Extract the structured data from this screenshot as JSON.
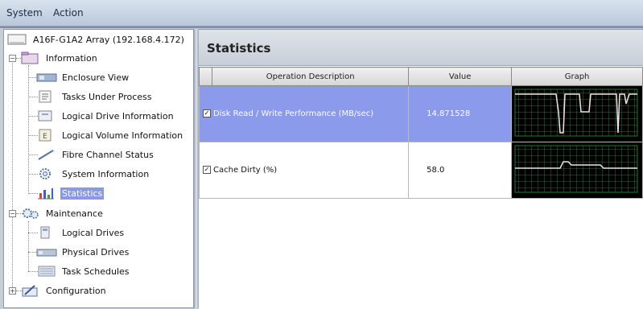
{
  "menu": {
    "items": [
      "System",
      "Action"
    ]
  },
  "tree": {
    "root": "A16F-G1A2 Array (192.168.4.172)",
    "information": {
      "label": "Information",
      "children": [
        "Enclosure View",
        "Tasks Under Process",
        "Logical Drive Information",
        "Logical Volume Information",
        "Fibre Channel Status",
        "System Information",
        "Statistics"
      ]
    },
    "maintenance": {
      "label": "Maintenance",
      "children": [
        "Logical Drives",
        "Physical Drives",
        "Task Schedules"
      ]
    },
    "configuration": {
      "label": "Configuration"
    },
    "selected": "Statistics"
  },
  "statistics": {
    "title": "Statistics",
    "columns": [
      "Operation Description",
      "Value",
      "Graph"
    ],
    "rows": [
      {
        "checked": true,
        "description": "Disk Read / Write Performance (MB/sec)",
        "value": "14.871528"
      },
      {
        "checked": true,
        "description": "Cache Dirty (%)",
        "value": "58.0"
      }
    ]
  },
  "colors": {
    "selection": "#8a99e6",
    "graph_background": "#000000",
    "graph_grid": "#1f7a2a",
    "graph_line": "#e8e8e8"
  }
}
